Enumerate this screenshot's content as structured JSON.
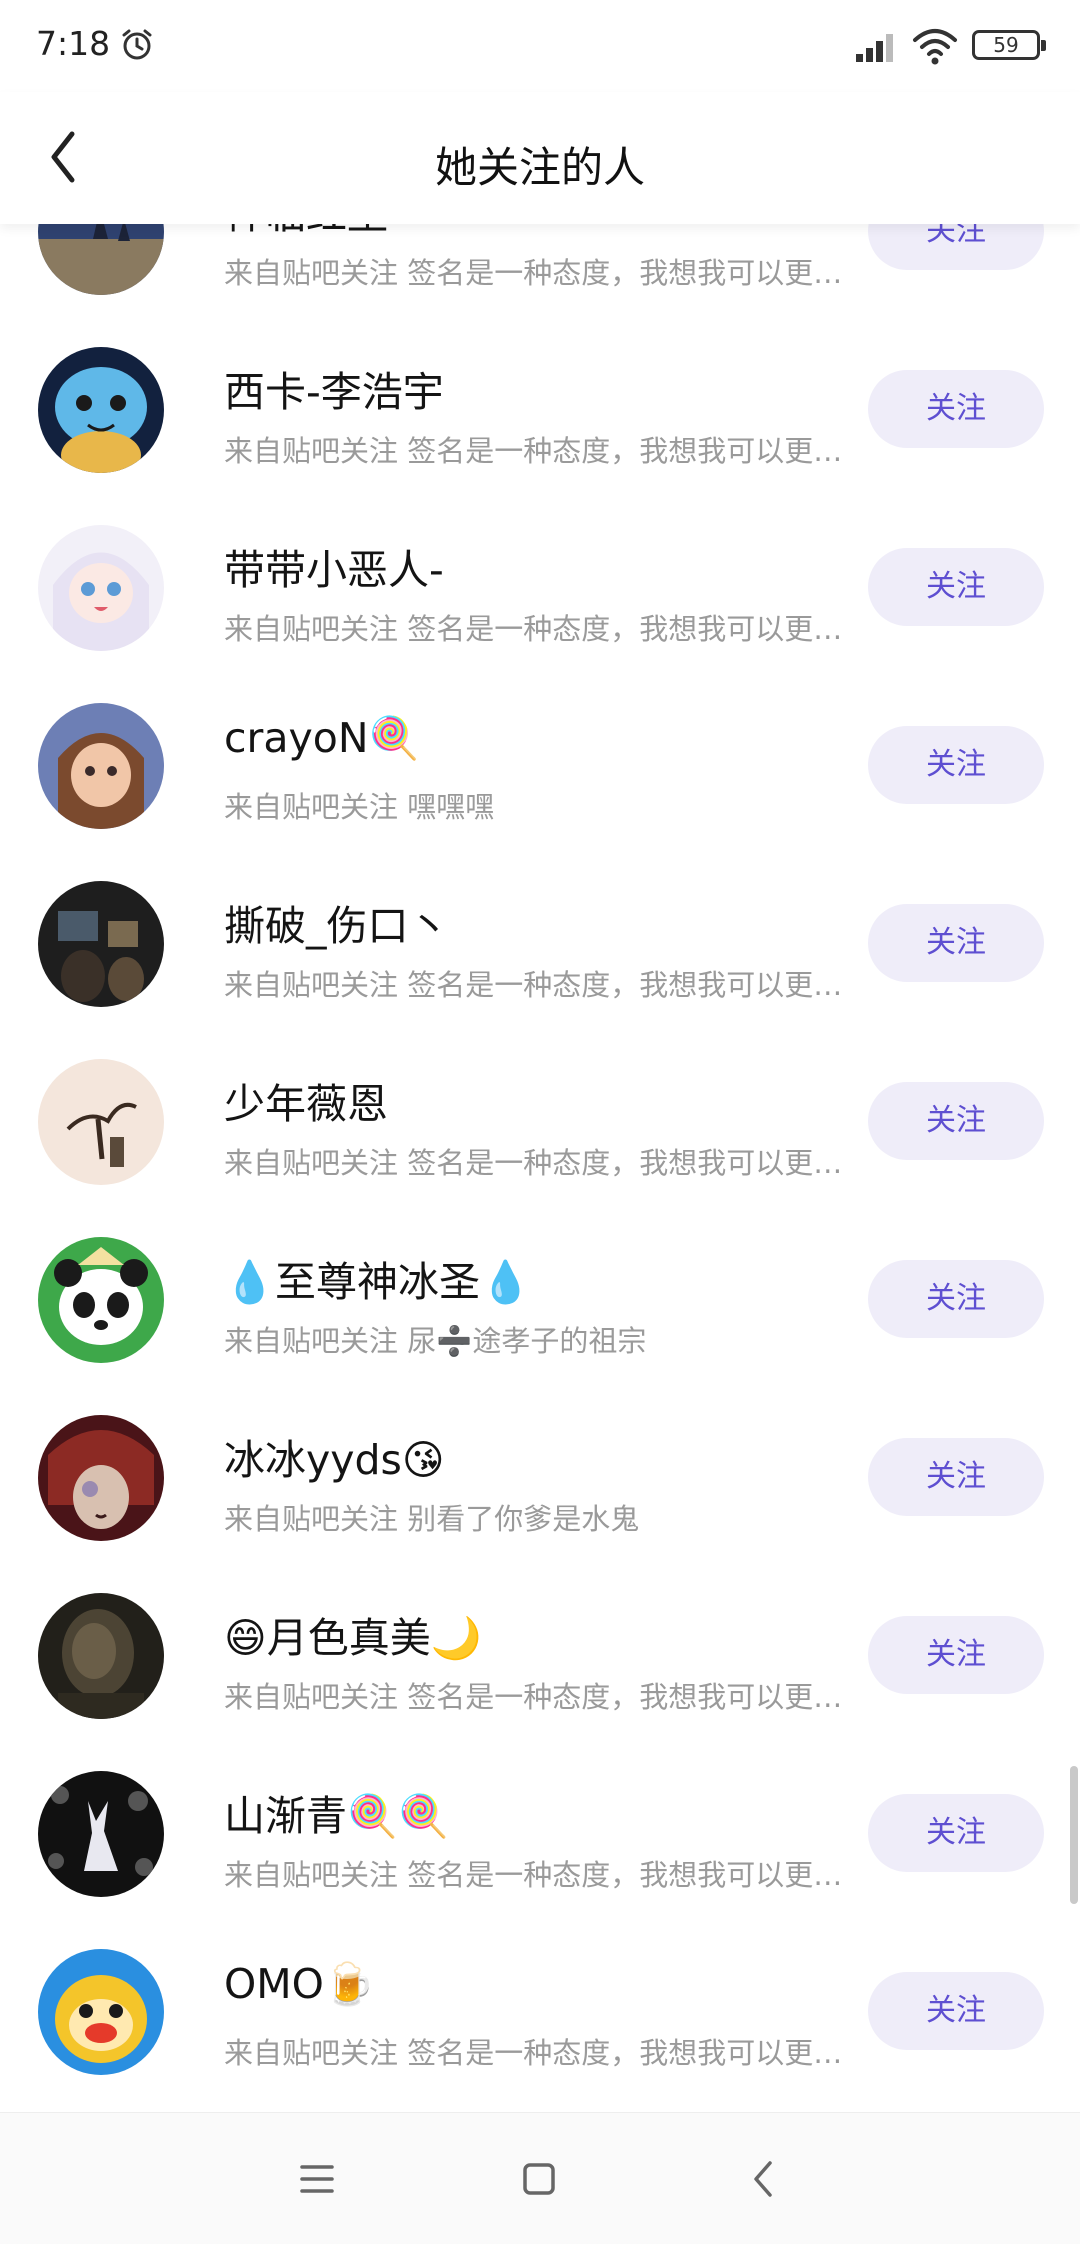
{
  "status_bar": {
    "time": "7:18",
    "battery": "59"
  },
  "nav": {
    "title": "她关注的人"
  },
  "users": [
    {
      "name": "神临红尘",
      "desc": "来自贴吧关注 签名是一种态度，我想我可以更酷…",
      "follow_label": "关注"
    },
    {
      "name": "西卡-李浩宇",
      "desc": "来自贴吧关注 签名是一种态度，我想我可以更酷…",
      "follow_label": "关注"
    },
    {
      "name": "带带小恶人-",
      "desc": "来自贴吧关注 签名是一种态度，我想我可以更酷…",
      "follow_label": "关注"
    },
    {
      "name": "crayoN🍭",
      "desc": "来自贴吧关注 嘿嘿嘿",
      "follow_label": "关注"
    },
    {
      "name": "撕破_伤口丶",
      "desc": "来自贴吧关注 签名是一种态度，我想我可以更酷…",
      "follow_label": "关注"
    },
    {
      "name": "少年薇恩",
      "desc": "来自贴吧关注 签名是一种态度，我想我可以更酷…",
      "follow_label": "关注"
    },
    {
      "name": "💧至尊神冰圣💧",
      "desc": "来自贴吧关注 尿➗途孝子的祖宗",
      "follow_label": "关注"
    },
    {
      "name": "冰冰yyds😘",
      "desc": "来自贴吧关注 别看了你爹是水鬼",
      "follow_label": "关注"
    },
    {
      "name": "😄月色真美🌙",
      "desc": "来自贴吧关注 签名是一种态度，我想我可以更酷…",
      "follow_label": "关注"
    },
    {
      "name": "山渐青🍭🍭",
      "desc": "来自贴吧关注 签名是一种态度，我想我可以更酷…",
      "follow_label": "关注"
    },
    {
      "name": "OMO🍺",
      "desc": "来自贴吧关注 签名是一种态度，我想我可以更酷…",
      "follow_label": "关注"
    }
  ],
  "icons": {
    "back": "chevron-left-icon",
    "menu": "menu-icon",
    "home": "home-square-icon",
    "sys_back": "sys-back-icon"
  },
  "colors": {
    "accent": "#5e4fd1",
    "follow_bg": "#efedf9",
    "secondary_text": "#9a9a9a"
  }
}
